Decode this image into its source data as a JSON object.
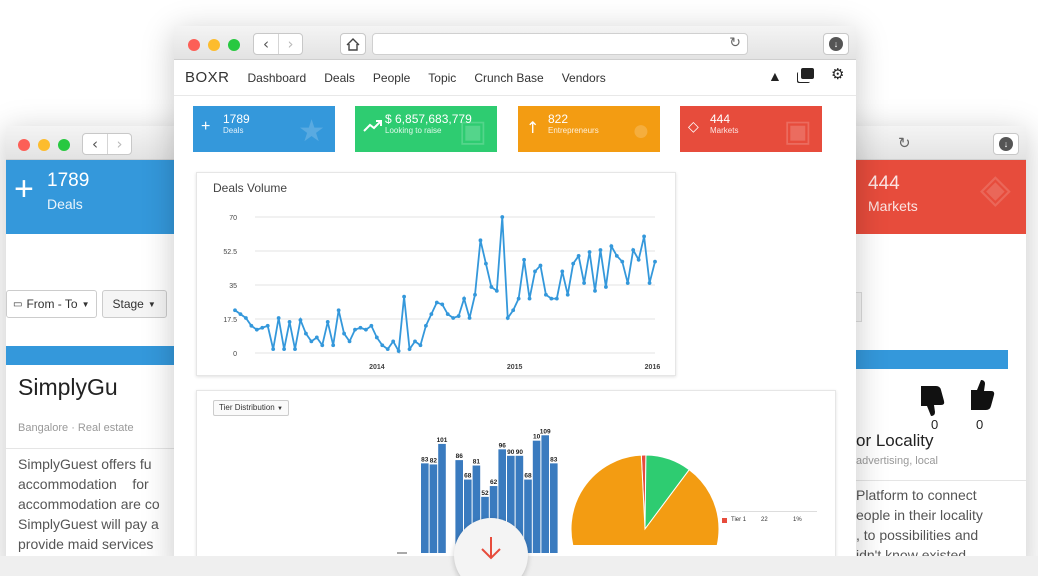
{
  "colors": {
    "blue": "#3498db",
    "green": "#2ecc71",
    "orange": "#f39c12",
    "red": "#e74c3c",
    "accent": "#e74c3c"
  },
  "main": {
    "brand": "BOXR",
    "nav": [
      "Dashboard",
      "Deals",
      "People",
      "Topic",
      "Crunch Base",
      "Vendors"
    ],
    "tiles": [
      {
        "value": "1789",
        "label": "Deals",
        "icon": "plus-icon"
      },
      {
        "value": "$ 6,857,683,779",
        "label": "Looking to raise",
        "icon": "trend-up-icon"
      },
      {
        "value": "822",
        "label": "Entrepreneurs",
        "icon": "arrow-up-icon"
      },
      {
        "value": "444",
        "label": "Markets",
        "icon": "tag-icon"
      }
    ],
    "deals_title": "Deals Volume",
    "tier_dropdown": "Tier Distribution",
    "tier_row": {
      "name": "Tier 1",
      "count": "22",
      "pct": "1%"
    }
  },
  "left": {
    "stat_value": "1789",
    "stat_label": "Deals",
    "filter_date": "From - To",
    "filter_stage": "Stage",
    "company": "SimplyGu",
    "meta": "Bangalore · Real estate",
    "desc_lines": [
      "SimplyGuest offers fu",
      "accommodation    for",
      "accommodation are co",
      "SimplyGuest will pay a",
      "provide maid services"
    ]
  },
  "right": {
    "stat_value": "444",
    "stat_label": "Markets",
    "company": "or Locality",
    "meta": "advertising, local",
    "down_count": "0",
    "up_count": "0",
    "desc_lines": [
      "Platform to connect",
      "eople in their locality",
      ", to possibilities and",
      "idn't know existed"
    ]
  },
  "chart_data": [
    {
      "type": "line",
      "title": "Deals Volume",
      "xlabel": "",
      "ylabel": "",
      "xticks": [
        "2014",
        "2015",
        "2016"
      ],
      "yticks": [
        0,
        17.5,
        35,
        52.5,
        70
      ],
      "ylim": [
        0,
        70
      ],
      "grid": true,
      "series": [
        {
          "values": [
            22,
            20,
            18,
            14,
            12,
            13,
            14,
            2,
            18,
            2,
            16,
            2,
            17,
            10,
            6,
            8,
            4,
            16,
            4,
            22,
            10,
            6,
            12,
            13,
            12,
            14,
            8,
            4,
            2,
            6,
            1,
            29,
            2,
            6,
            4,
            14,
            20,
            26,
            25,
            20,
            18,
            19,
            28,
            18,
            30,
            58,
            46,
            34,
            32,
            70,
            18,
            22,
            28,
            48,
            28,
            42,
            45,
            30,
            28,
            28,
            42,
            30,
            46,
            50,
            36,
            52,
            32,
            53,
            34,
            55,
            50,
            47,
            36,
            53,
            48,
            60,
            36,
            47
          ]
        }
      ]
    },
    {
      "type": "bar",
      "title": "",
      "data_labels": [
        "83",
        "82",
        "101",
        "86",
        "68",
        "81",
        "52",
        "62",
        "96",
        "90",
        "90",
        "68",
        "10",
        "109",
        "83"
      ],
      "values": [
        83,
        82,
        101,
        0,
        86,
        68,
        81,
        52,
        62,
        96,
        90,
        90,
        68,
        104,
        109,
        83
      ]
    },
    {
      "type": "pie",
      "title": "",
      "legend": [
        {
          "name": "Tier 1",
          "value": "22",
          "pct": "1%"
        }
      ],
      "slices": [
        {
          "color": "#e74c3c",
          "value": 1
        },
        {
          "color": "#2ecc71",
          "value": 10
        },
        {
          "color": "#f39c12",
          "value": 89
        }
      ]
    }
  ]
}
